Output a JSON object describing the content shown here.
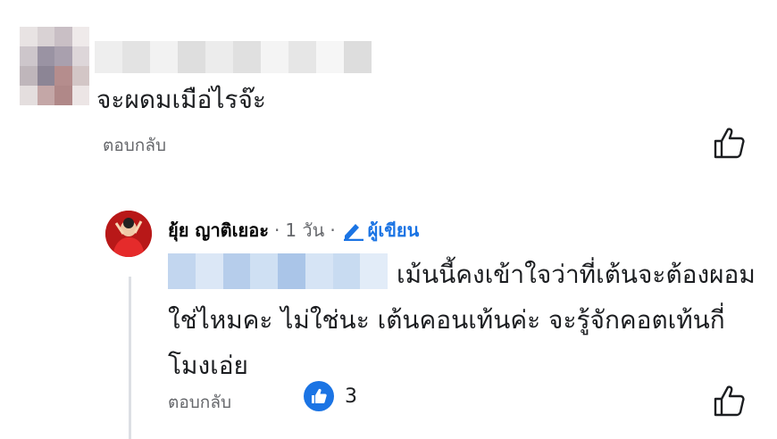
{
  "comment1": {
    "text": "จะผดมเมือ่ไรจ๊ะ",
    "reply_label": "ตอบกลับ",
    "like_icon": "like-outline-icon"
  },
  "comment2": {
    "author_name": "ยุ้ย ญาติเยอะ",
    "separator": "·",
    "time": "1 วัน",
    "author_badge": "ผู้เขียน",
    "author_badge_icon": "pencil-icon",
    "text": "เม้นนี้คงเข้าใจว่าที่เต้นจะต้องผอมใช่ไหมคะ ไม่ใช่นะ เต้นคอนเท้นค่ะ จะรู้จักคอตเท้นกี่โมงเอ่ย",
    "reply_label": "ตอบกลับ",
    "reaction_icon": "thumbs-up-reaction-icon",
    "reaction_count": "3",
    "like_icon": "like-outline-icon"
  },
  "colors": {
    "link_blue": "#1b74e4",
    "secondary_text": "#65676b",
    "thread_line": "#dcdfe4"
  }
}
